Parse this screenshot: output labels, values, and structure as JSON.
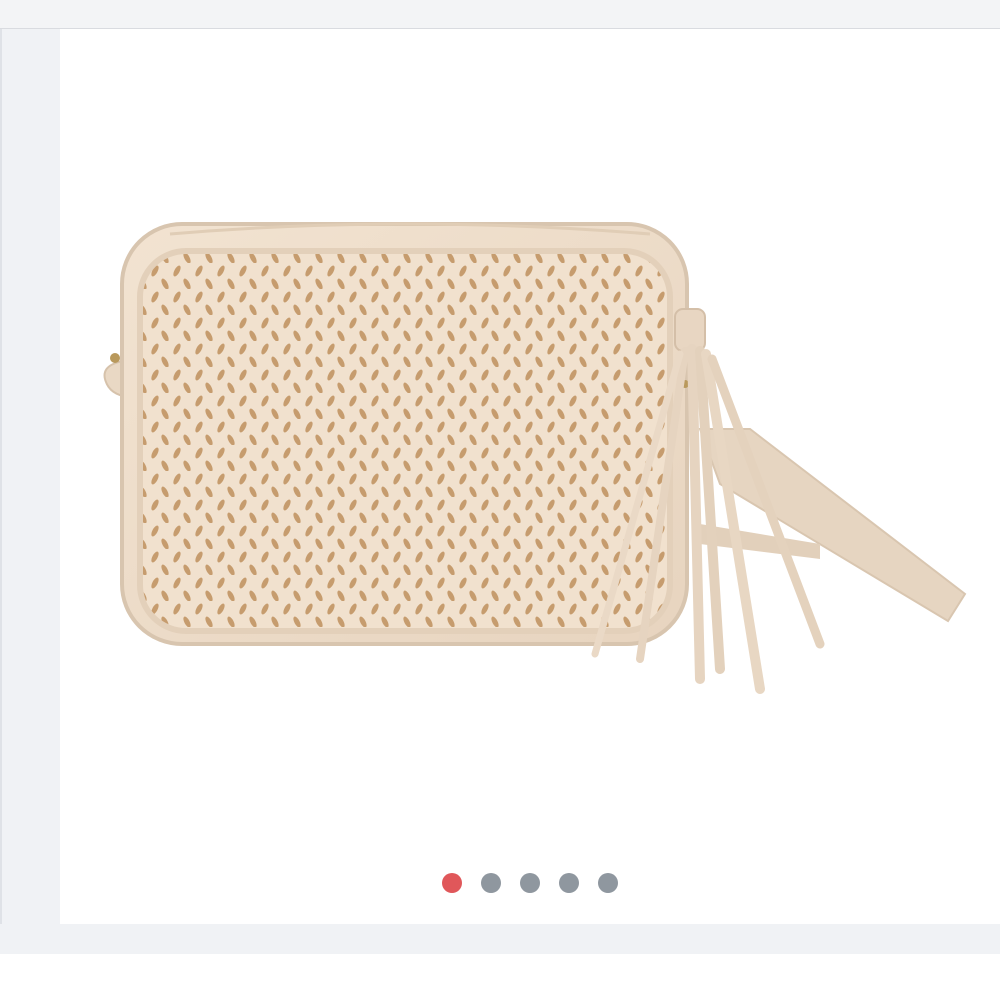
{
  "carousel": {
    "slide_count": 5,
    "active_index": 0,
    "image_subject": "beige-perforated-crossbody-bag-with-tassel"
  },
  "colors": {
    "bag_body": "#eddcc8",
    "bag_trim": "#e4d3bf",
    "perforation": "#c9a37a",
    "dot_active": "#e0575a",
    "dot_inactive": "#8f979f",
    "chrome_background": "#f0f2f5"
  }
}
